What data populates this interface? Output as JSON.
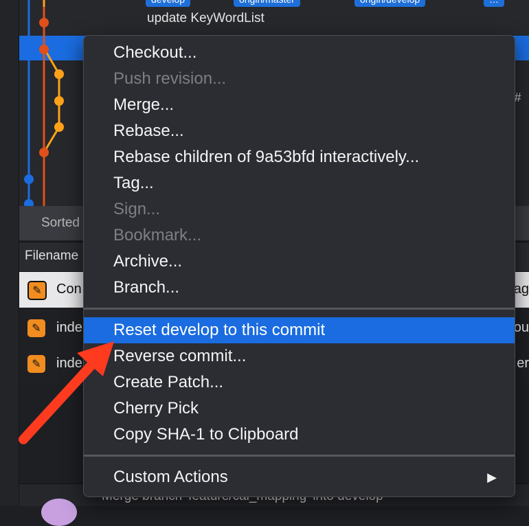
{
  "commit": {
    "message": "update KeyWordList"
  },
  "tags": [
    {
      "label": "develop"
    },
    {
      "label": "origin/master"
    },
    {
      "label": "origin/develop"
    },
    {
      "label": "…"
    }
  ],
  "right_snippets": [
    "e '#",
    "e '"
  ],
  "sorted": {
    "label": "Sorted"
  },
  "filename": {
    "label": "Filename"
  },
  "files": [
    {
      "name": "Con",
      "right": "ag"
    },
    {
      "name": "inde",
      "right": "ou"
    },
    {
      "name": "inde",
      "right": "er"
    }
  ],
  "bottom": {
    "text": "Merge branch 'feature/cal_mapping' into develop"
  },
  "menu": {
    "items": [
      {
        "label": "Checkout...",
        "enabled": true
      },
      {
        "label": "Push revision...",
        "enabled": false
      },
      {
        "label": "Merge...",
        "enabled": true
      },
      {
        "label": "Rebase...",
        "enabled": true
      },
      {
        "label": "Rebase children of 9a53bfd interactively...",
        "enabled": true
      },
      {
        "label": "Tag...",
        "enabled": true
      },
      {
        "label": "Sign...",
        "enabled": false
      },
      {
        "label": "Bookmark...",
        "enabled": false
      },
      {
        "label": "Archive...",
        "enabled": true
      },
      {
        "label": "Branch...",
        "enabled": true
      },
      {
        "label": "Reset develop to this commit",
        "enabled": true,
        "highlighted": true
      },
      {
        "label": "Reverse commit...",
        "enabled": true
      },
      {
        "label": "Create Patch...",
        "enabled": true
      },
      {
        "label": "Cherry Pick",
        "enabled": true
      },
      {
        "label": "Copy SHA-1 to Clipboard",
        "enabled": true
      },
      {
        "label": "Custom Actions",
        "enabled": true,
        "submenu": true
      }
    ]
  },
  "colors": {
    "accent": "#1a6ce0",
    "arrow": "#ff3b1f",
    "graph_orange": "#ffa21a",
    "graph_red": "#e0501a",
    "graph_blue": "#1a6ce0"
  }
}
